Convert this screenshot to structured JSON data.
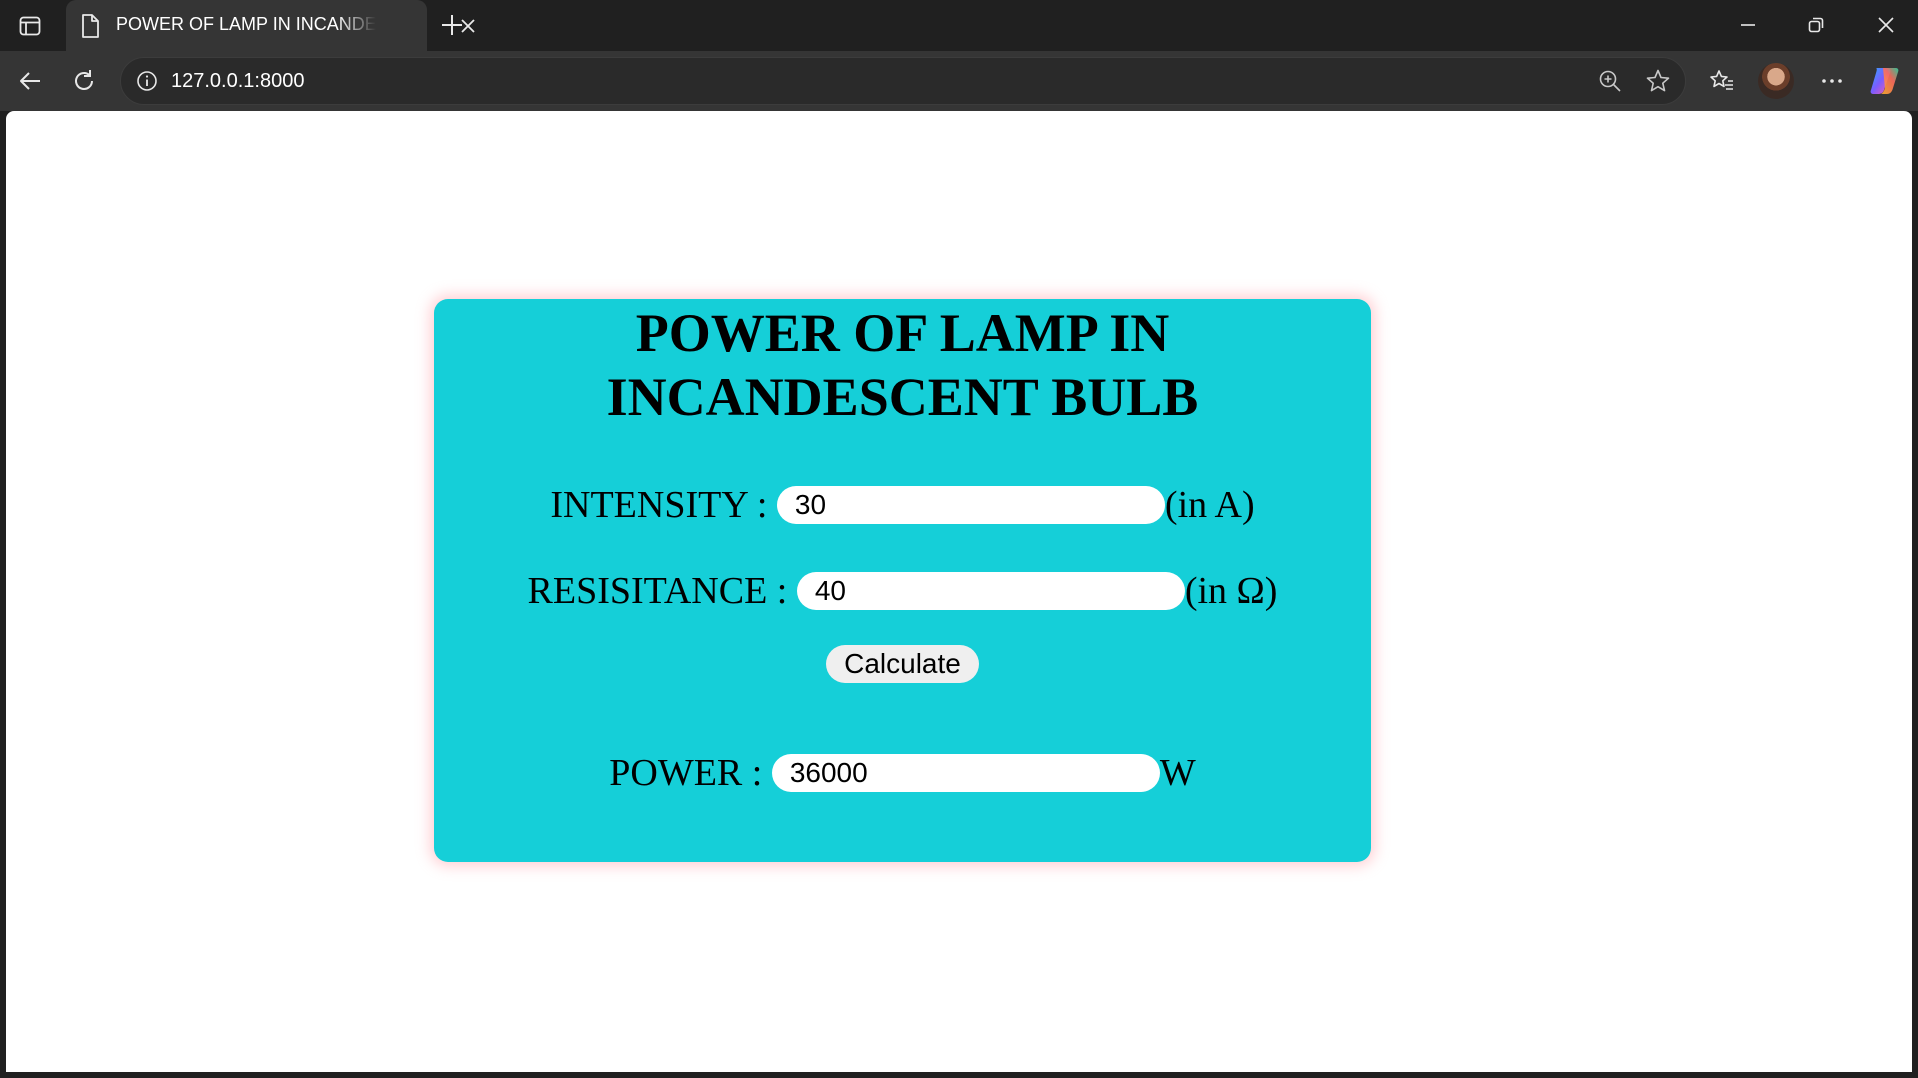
{
  "browser": {
    "tab_title": "POWER OF LAMP IN INCANDESCENT BULB",
    "url": "127.0.0.1:8000"
  },
  "page": {
    "heading": "POWER OF LAMP IN INCANDESCENT BULB",
    "intensity": {
      "label": "INTENSITY : ",
      "value": "30",
      "unit": "(in A)"
    },
    "resistance": {
      "label": "RESISITANCE : ",
      "value": "40",
      "unit": "(in Ω)"
    },
    "calculate_label": "Calculate",
    "power": {
      "label": "POWER : ",
      "value": "36000",
      "unit": "W"
    }
  },
  "colors": {
    "card_background": "#15cfd8",
    "card_glow": "#ff96a0",
    "chrome_dark": "#202020",
    "toolbar": "#353535"
  }
}
